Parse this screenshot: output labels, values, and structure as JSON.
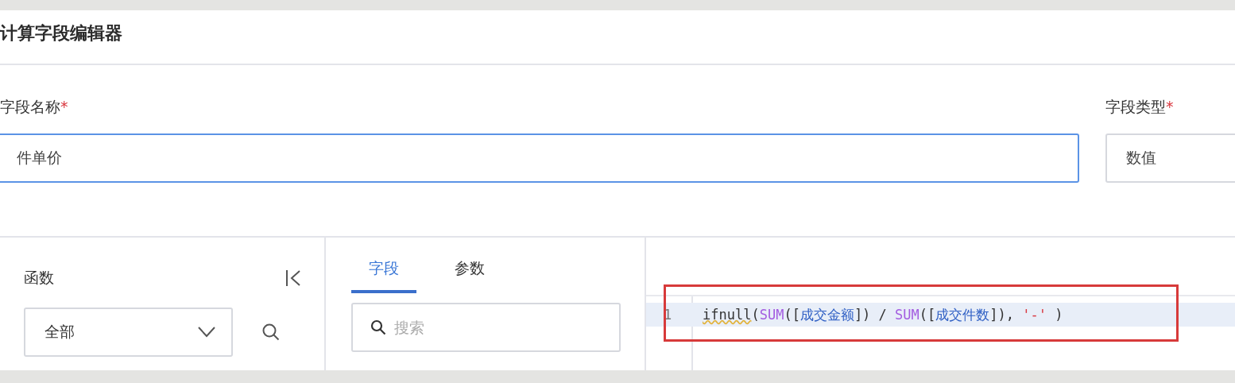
{
  "title": "计算字段编辑器",
  "name_field": {
    "label": "字段名称",
    "required_mark": "*",
    "value": "件单价",
    "focused": true
  },
  "type_field": {
    "label": "字段类型",
    "required_mark": "*",
    "value": "数值"
  },
  "functions_panel": {
    "label": "函数",
    "category": "全部"
  },
  "tabs": [
    {
      "label": "字段",
      "selected": true
    },
    {
      "label": "参数",
      "selected": false
    }
  ],
  "search": {
    "placeholder": "搜索"
  },
  "editor": {
    "lines": [
      {
        "number": "1",
        "highlighted": true,
        "tokens": [
          {
            "text": "ifnull",
            "kind": "warning"
          },
          {
            "text": "(",
            "kind": "plain"
          },
          {
            "text": "SUM",
            "kind": "function"
          },
          {
            "text": "([",
            "kind": "plain"
          },
          {
            "text": "成交金额",
            "kind": "field"
          },
          {
            "text": "]) / ",
            "kind": "plain"
          },
          {
            "text": "SUM",
            "kind": "function"
          },
          {
            "text": "([",
            "kind": "plain"
          },
          {
            "text": "成交件数",
            "kind": "field"
          },
          {
            "text": "]), ",
            "kind": "plain"
          },
          {
            "text": "'-'",
            "kind": "string"
          },
          {
            "text": " )",
            "kind": "plain"
          }
        ]
      }
    ]
  }
}
